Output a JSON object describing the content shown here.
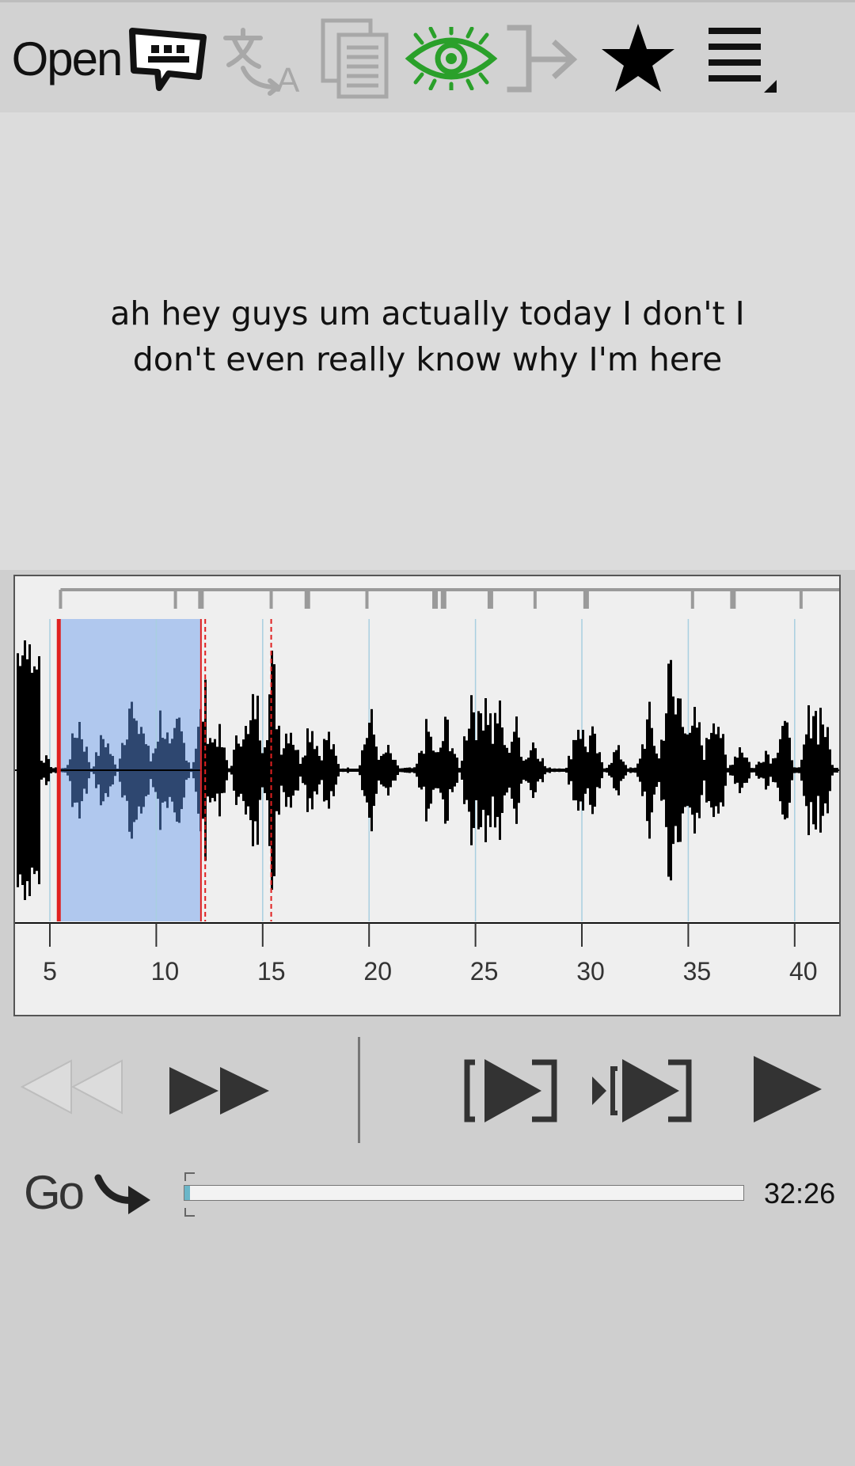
{
  "toolbar": {
    "open_label": "Open",
    "icons": [
      "subtitle-icon",
      "translate-icon",
      "document-icon",
      "eye-icon",
      "exit-icon",
      "star-icon",
      "menu-icon"
    ],
    "eye_color": "#2aa02a"
  },
  "subtitle": {
    "text": "ah hey guys um actually today I don't I don't even really know why I'm here"
  },
  "waveform": {
    "tick_labels": [
      "5",
      "10",
      "15",
      "20",
      "25",
      "30",
      "35",
      "40"
    ],
    "selection_color": "#b0c8ee",
    "marker_color": "#e02020"
  },
  "transport": {
    "icons": [
      "rewind-icon",
      "fast-forward-icon",
      "play-selection-icon",
      "play-from-marker-icon",
      "play-icon"
    ]
  },
  "go_row": {
    "go_label": "Go",
    "progress": 0.01,
    "duration": "32:26"
  }
}
